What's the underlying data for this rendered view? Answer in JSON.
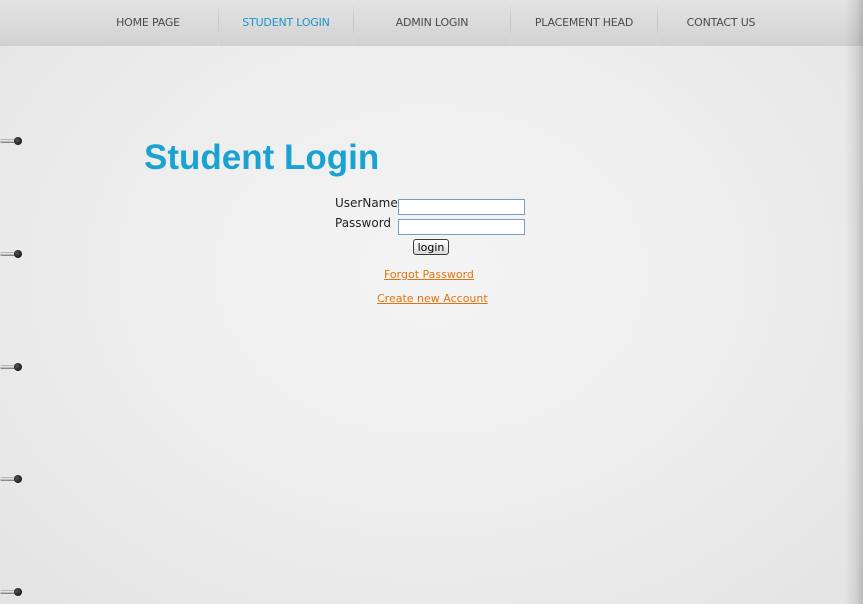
{
  "nav": {
    "items": [
      {
        "label": "HOME PAGE"
      },
      {
        "label": "STUDENT LOGIN"
      },
      {
        "label": "ADMIN LOGIN"
      },
      {
        "label": "PLACEMENT HEAD"
      },
      {
        "label": "CONTACT US"
      }
    ],
    "active_index": 1
  },
  "page_title": "Student Login",
  "form": {
    "username_label": "UserName",
    "username_value": "",
    "password_label": "Password",
    "password_value": "",
    "login_label": "login"
  },
  "links": {
    "forgot_password": "Forgot Password",
    "create_account": "Create new Account"
  },
  "colors": {
    "title": "#1aa3d2",
    "active_nav": "#1a96c8",
    "link": "#e0730e"
  }
}
